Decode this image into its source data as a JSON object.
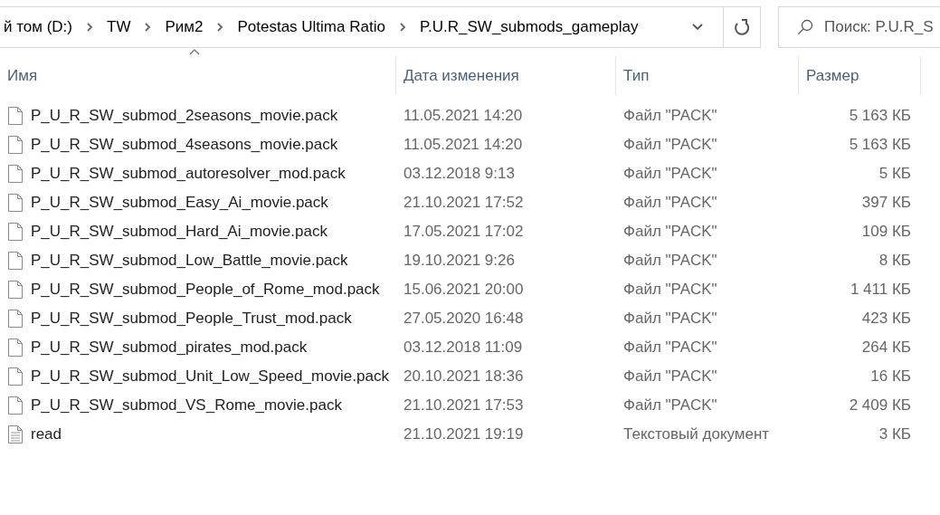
{
  "address_bar": {
    "breadcrumbs": [
      "й том (D:)",
      "TW",
      "Рим2",
      "Potestas Ultima Ratio",
      "P.U.R_SW_submods_gameplay"
    ]
  },
  "search": {
    "placeholder": "Поиск: P.U.R_S"
  },
  "table": {
    "columns": [
      {
        "label": "Имя",
        "sorted": true
      },
      {
        "label": "Дата изменения",
        "sorted": false
      },
      {
        "label": "Тип",
        "sorted": false
      },
      {
        "label": "Размер",
        "sorted": false
      }
    ],
    "rows": [
      {
        "kind": "pack",
        "name": "P_U_R_SW_submod_2seasons_movie.pack",
        "date": "11.05.2021 14:20",
        "type": "Файл \"PACK\"",
        "size": "5 163 КБ"
      },
      {
        "kind": "pack",
        "name": "P_U_R_SW_submod_4seasons_movie.pack",
        "date": "11.05.2021 14:20",
        "type": "Файл \"PACK\"",
        "size": "5 163 КБ"
      },
      {
        "kind": "pack",
        "name": "P_U_R_SW_submod_autoresolver_mod.pack",
        "date": "03.12.2018 9:13",
        "type": "Файл \"PACK\"",
        "size": "5 КБ"
      },
      {
        "kind": "pack",
        "name": "P_U_R_SW_submod_Easy_Ai_movie.pack",
        "date": "21.10.2021 17:52",
        "type": "Файл \"PACK\"",
        "size": "397 КБ"
      },
      {
        "kind": "pack",
        "name": "P_U_R_SW_submod_Hard_Ai_movie.pack",
        "date": "17.05.2021 17:02",
        "type": "Файл \"PACK\"",
        "size": "109 КБ"
      },
      {
        "kind": "pack",
        "name": "P_U_R_SW_submod_Low_Battle_movie.pack",
        "date": "19.10.2021 9:26",
        "type": "Файл \"PACK\"",
        "size": "8 КБ"
      },
      {
        "kind": "pack",
        "name": "P_U_R_SW_submod_People_of_Rome_mod.pack",
        "date": "15.06.2021 20:00",
        "type": "Файл \"PACK\"",
        "size": "1 411 КБ"
      },
      {
        "kind": "pack",
        "name": "P_U_R_SW_submod_People_Trust_mod.pack",
        "date": "27.05.2020 16:48",
        "type": "Файл \"PACK\"",
        "size": "423 КБ"
      },
      {
        "kind": "pack",
        "name": "P_U_R_SW_submod_pirates_mod.pack",
        "date": "03.12.2018 11:09",
        "type": "Файл \"PACK\"",
        "size": "264 КБ"
      },
      {
        "kind": "pack",
        "name": "P_U_R_SW_submod_Unit_Low_Speed_movie.pack",
        "date": "20.10.2021 18:36",
        "type": "Файл \"PACK\"",
        "size": "16 КБ"
      },
      {
        "kind": "pack",
        "name": "P_U_R_SW_submod_VS_Rome_movie.pack",
        "date": "21.10.2021 17:53",
        "type": "Файл \"PACK\"",
        "size": "2 409 КБ"
      },
      {
        "kind": "text",
        "name": "read",
        "date": "21.10.2021 19:19",
        "type": "Текстовый документ",
        "size": "3 КБ"
      }
    ]
  }
}
